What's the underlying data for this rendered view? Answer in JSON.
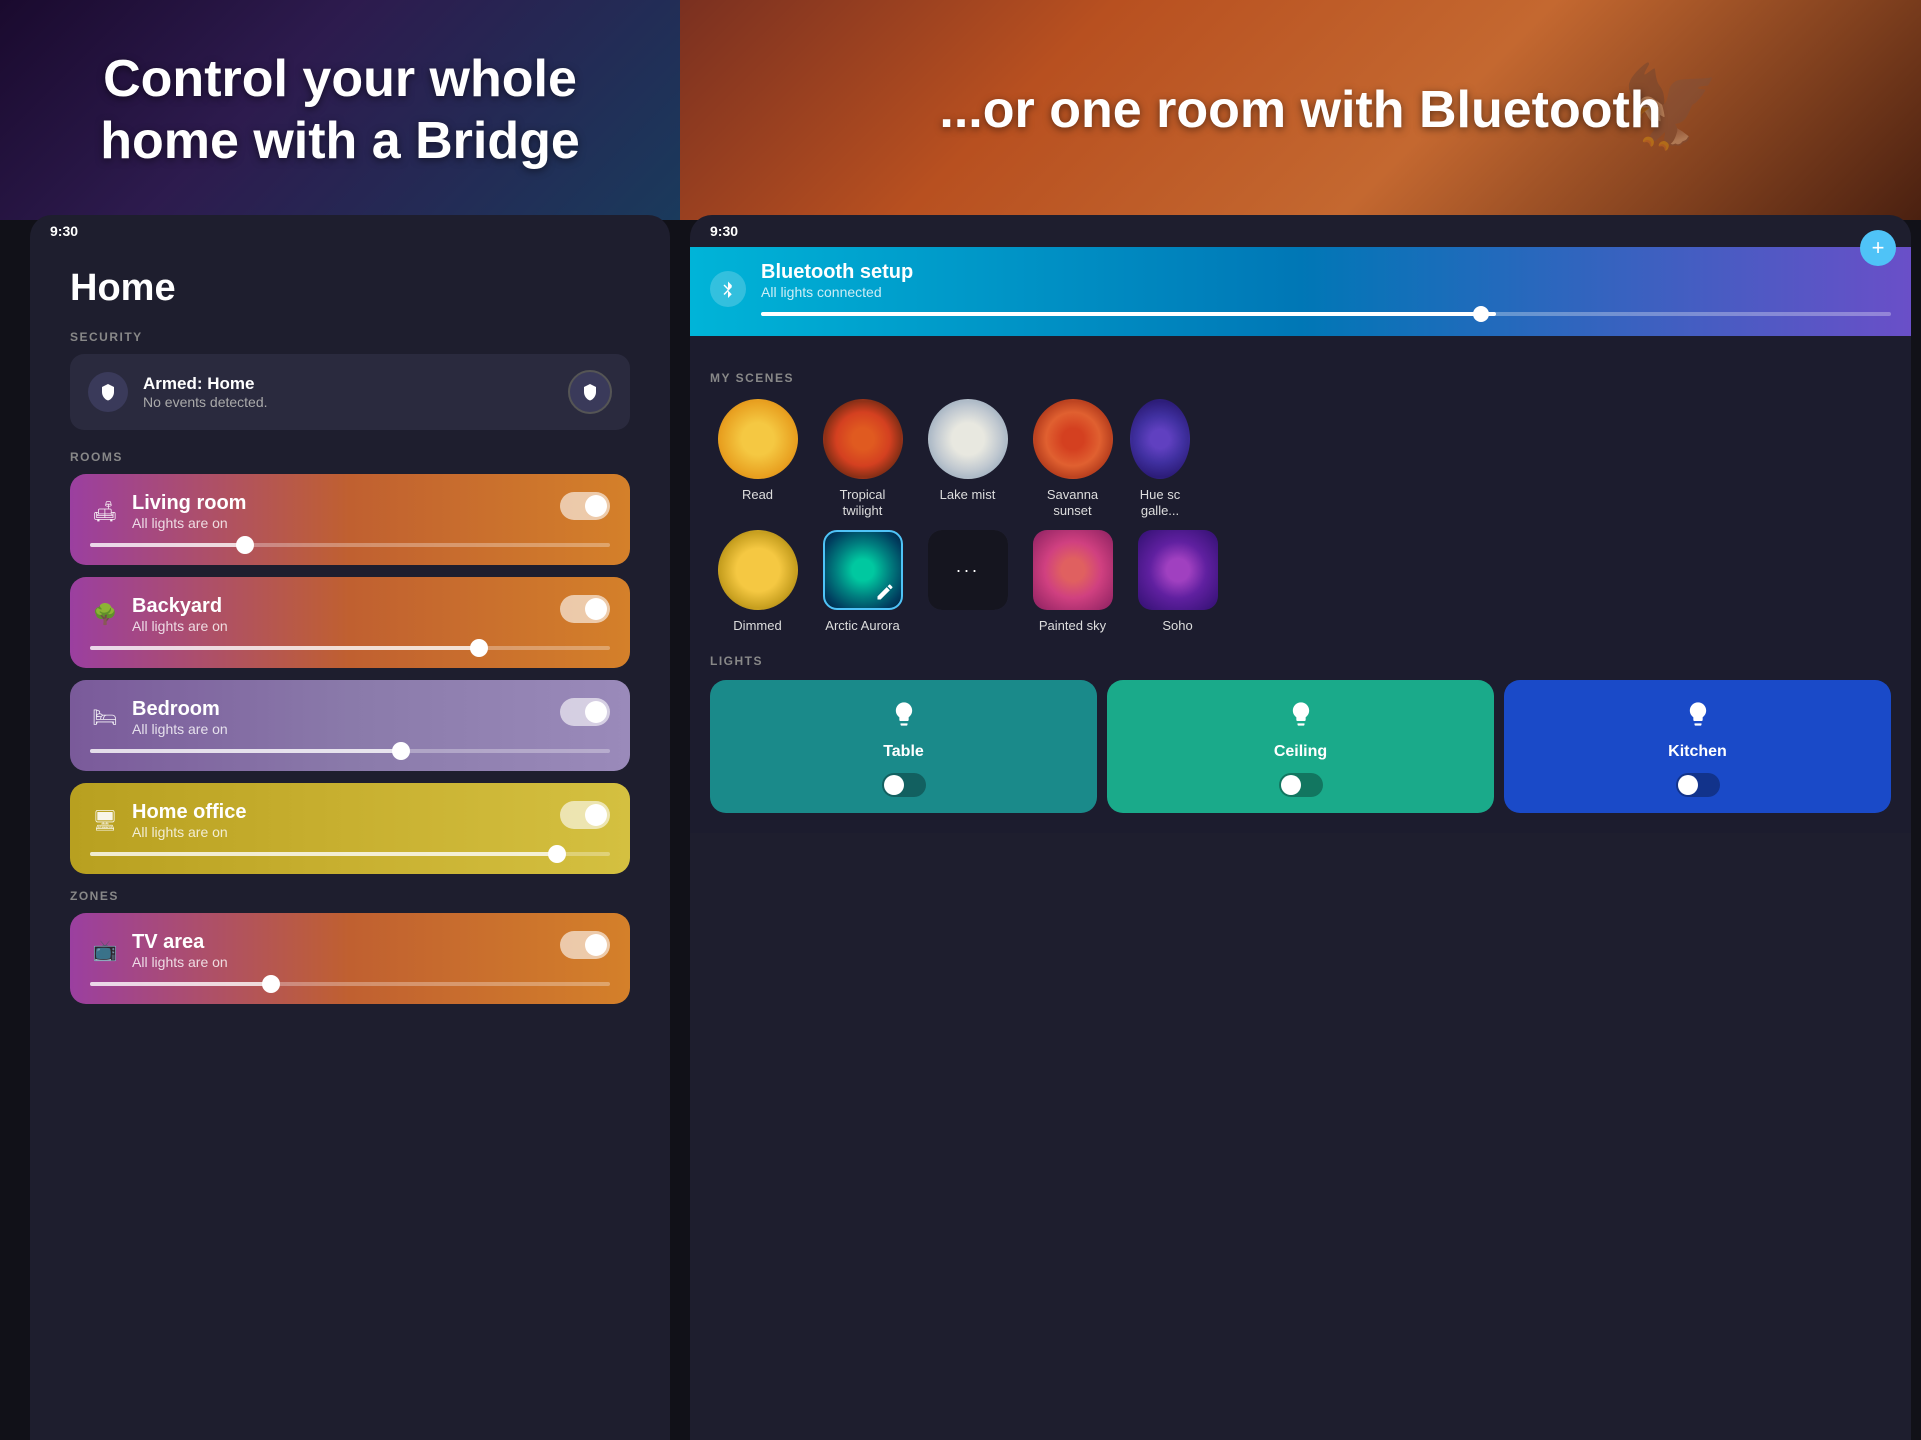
{
  "header": {
    "left_title": "Control your whole home with a Bridge",
    "right_title": "...or one room with Bluetooth"
  },
  "left_device": {
    "status_time": "9:30",
    "home_title": "Home",
    "security": {
      "label": "SECURITY",
      "name": "Armed: Home",
      "status": "No events detected."
    },
    "rooms_label": "ROOMS",
    "rooms": [
      {
        "name": "Living room",
        "status": "All lights are on",
        "icon": "🛋",
        "slider_pos": "30%",
        "on": true
      },
      {
        "name": "Backyard",
        "status": "All lights are on",
        "icon": "🌳",
        "slider_pos": "75%",
        "on": true
      },
      {
        "name": "Bedroom",
        "status": "All lights are on",
        "icon": "🛏",
        "slider_pos": "60%",
        "on": true
      },
      {
        "name": "Home office",
        "status": "All lights are on",
        "icon": "🖥",
        "slider_pos": "90%",
        "on": true
      }
    ],
    "zones_label": "ZONES",
    "zones": [
      {
        "name": "TV area",
        "status": "All lights are on",
        "icon": "📺",
        "slider_pos": "35%",
        "on": true
      }
    ]
  },
  "right_device": {
    "status_time": "9:30",
    "bluetooth": {
      "title": "Bluetooth setup",
      "subtitle": "All lights connected",
      "progress": 65
    },
    "scenes_label": "MY SCENES",
    "scenes_row1": [
      {
        "name": "Read",
        "type": "read"
      },
      {
        "name": "Tropical\ntwilight",
        "type": "tropical"
      },
      {
        "name": "Lake mist",
        "type": "lake"
      },
      {
        "name": "Savanna\nsunset",
        "type": "savanna"
      },
      {
        "name": "Hue sc\ngallery",
        "type": "hue",
        "partial": true
      }
    ],
    "scenes_row2": [
      {
        "name": "Dimmed",
        "type": "dimmed"
      },
      {
        "name": "Arctic Aurora",
        "type": "arctic",
        "active": true
      },
      {
        "name": "...",
        "type": "more"
      },
      {
        "name": "Painted sky",
        "type": "painted"
      },
      {
        "name": "Soho",
        "type": "soho"
      }
    ],
    "lights_label": "LIGHTS",
    "lights": [
      {
        "name": "Table",
        "type": "table"
      },
      {
        "name": "Ceiling",
        "type": "ceiling"
      },
      {
        "name": "Kitchen",
        "type": "kitchen"
      }
    ]
  }
}
